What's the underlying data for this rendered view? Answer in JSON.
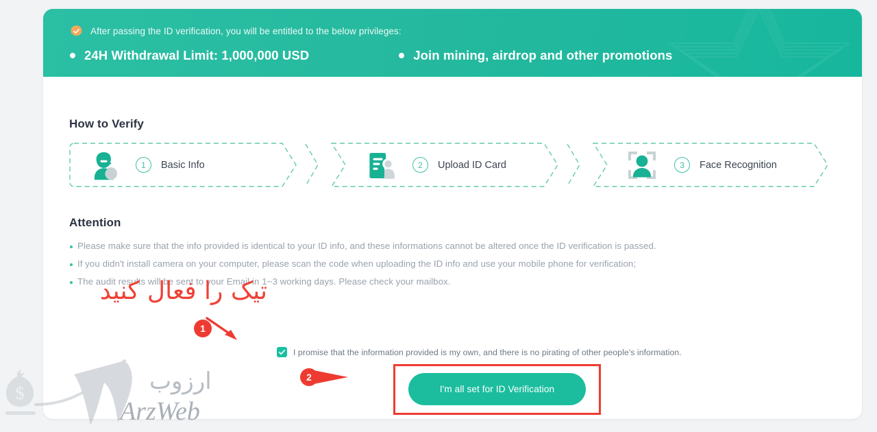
{
  "banner": {
    "badge_icon": "verified-rosette-icon",
    "note": "After passing the ID verification, you will be entitled to the below privileges:",
    "perks": [
      "24H Withdrawal Limit: 1,000,000 USD",
      "Join mining, airdrop and other promotions"
    ],
    "decoration_icon": "star-outline-decoration"
  },
  "sections": {
    "howto_title": "How to Verify",
    "attention_title": "Attention"
  },
  "steps": [
    {
      "number": "1",
      "label": "Basic Info",
      "icon": "person-badge-icon"
    },
    {
      "number": "2",
      "label": "Upload ID Card",
      "icon": "id-document-icon"
    },
    {
      "number": "3",
      "label": "Face Recognition",
      "icon": "face-scan-icon"
    }
  ],
  "attention_notes": [
    "Please make sure that the info provided is identical to your ID info, and these informations cannot be altered once the ID verification is passed.",
    "If you didn't install camera on your computer, please scan the code when uploading the ID info and use your mobile phone for verification;",
    "The audit results will be sent to your Email in 1~3 working days. Please check your mailbox."
  ],
  "consent": {
    "checked": true,
    "label": "I promise that the information provided is my own, and there is no pirating of other people's information."
  },
  "submit": {
    "label": "I'm all set for ID Verification"
  },
  "annotations": {
    "persian_instruction": "تیک را فعال کنید",
    "marker_1": "1",
    "marker_2": "2"
  },
  "watermark": {
    "persian": "ارزوب",
    "english": "ArzWeb",
    "icon": "money-bag-icon"
  },
  "colors": {
    "brand_green": "#1bbd9e",
    "banner_green": "#25b99f",
    "badge_orange": "#f5a95c",
    "annotation_red": "#ee3b32",
    "note_grey": "#9aa2ad",
    "step_outline": "#3fbfa6"
  }
}
